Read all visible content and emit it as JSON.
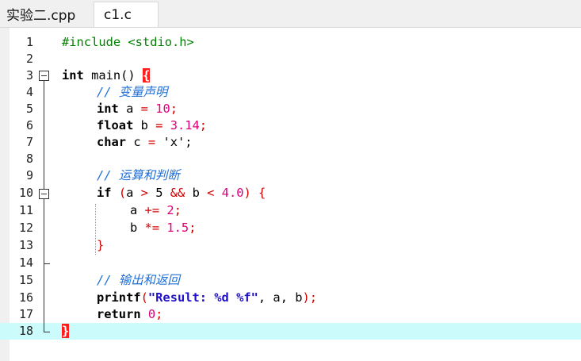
{
  "tabs": [
    {
      "label": "实验二.cpp",
      "active": false
    },
    {
      "label": "c1.c",
      "active": true
    }
  ],
  "editor": {
    "current_line": 18,
    "line_numbers": [
      "1",
      "2",
      "3",
      "4",
      "5",
      "6",
      "7",
      "8",
      "9",
      "10",
      "11",
      "12",
      "13",
      "14",
      "15",
      "16",
      "17",
      "18"
    ],
    "lines": {
      "l1": {
        "pp": "#include <stdio.h>"
      },
      "l3": {
        "kw": "int",
        "name": " main() ",
        "brace": "{"
      },
      "l4": {
        "comment": "// 变量声明"
      },
      "l5": {
        "kw": "int",
        "a": " a ",
        "op": "=",
        "sp": " ",
        "num": "10",
        "end": ";"
      },
      "l6": {
        "kw": "float",
        "a": " b ",
        "op": "=",
        "sp": " ",
        "num": "3.14",
        "end": ";"
      },
      "l7": {
        "kw": "char",
        "a": " c ",
        "op": "=",
        "rest": " 'x';"
      },
      "l9": {
        "comment": "// 运算和判断"
      },
      "l10": {
        "kw": "if",
        "p1": " ",
        "lp": "(",
        "a": "a ",
        "gt": ">",
        "sp1": " 5 ",
        "and": "&&",
        "b": " b ",
        "lt": "<",
        "sp2": " ",
        "num": "4.0",
        "rp": ")",
        "sp3": " ",
        "lb": "{"
      },
      "l11": {
        "a": "a ",
        "op": "+=",
        "sp": " ",
        "num": "2",
        "end": ";"
      },
      "l12": {
        "a": "b ",
        "op": "*=",
        "sp": " ",
        "num": "1.5",
        "end": ";"
      },
      "l13": {
        "rb": "}"
      },
      "l15": {
        "comment": "// 输出和返回"
      },
      "l16": {
        "fn": "printf",
        "lp": "(",
        "str": "\"Result: %d %f\"",
        "rest": ", a, b",
        "rp": ")",
        "end": ";"
      },
      "l17": {
        "kw": "return",
        "sp": " ",
        "num": "0",
        "end": ";"
      },
      "l18": {
        "brace": "}"
      }
    }
  },
  "colors": {
    "preprocessor": "#008000",
    "comment": "#1f6fd8",
    "number": "#e0007a",
    "operator": "#d40000",
    "string": "#1f10c8",
    "current_line_bg": "#ccfbfc",
    "brace_match": "#ff1e1e"
  }
}
